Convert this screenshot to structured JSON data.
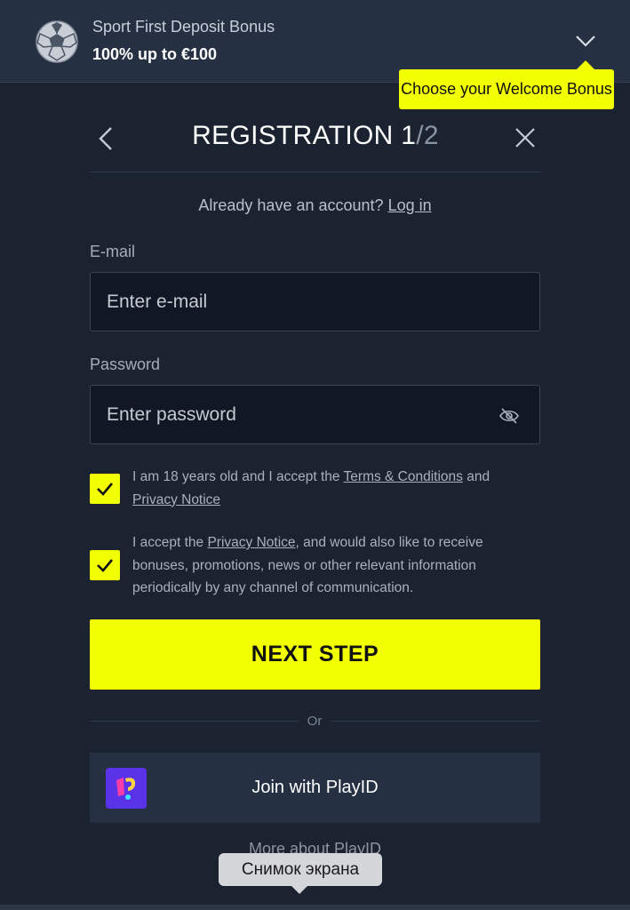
{
  "bonus": {
    "name": "Sport First Deposit Bonus",
    "amount": "100% up to €100",
    "icon": "soccer-ball-icon",
    "tooltip": "Choose your Welcome Bonus"
  },
  "header": {
    "title_main": "REGISTRATION 1",
    "title_sep": "/",
    "title_total": "2"
  },
  "login": {
    "prompt": "Already have an account?",
    "link": "Log in"
  },
  "form": {
    "email_label": "E-mail",
    "email_placeholder": "Enter e-mail",
    "email_value": "",
    "password_label": "Password",
    "password_placeholder": "Enter password",
    "password_value": ""
  },
  "consents": [
    {
      "checked": true,
      "text_before": "I am 18 years old and I accept the ",
      "link1": "Terms & Conditions",
      "text_mid": " and",
      "link2": "Privacy Notice"
    },
    {
      "checked": true,
      "text_before": "I accept the ",
      "link1": "Privacy Notice",
      "text_after": ", and would also like to receive bonuses, promotions, news or other relevant information periodically by any channel of communication."
    }
  ],
  "next_button": "NEXT STEP",
  "divider_text": "Or",
  "playid": {
    "label": "Join with PlayID",
    "more": "More about PlayID"
  },
  "system_tooltip": "Снимок экрана",
  "colors": {
    "accent": "#f2ff00",
    "background": "#1b2330",
    "panel": "#253143"
  }
}
